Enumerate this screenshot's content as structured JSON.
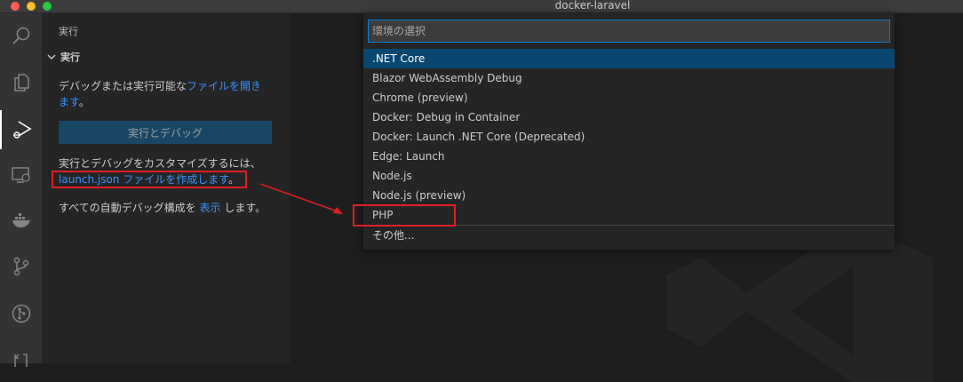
{
  "window": {
    "title": "docker-laravel"
  },
  "activity_bar": {
    "items": [
      "search-icon",
      "files-icon",
      "run-debug-icon",
      "remote-explorer-icon",
      "docker-icon",
      "source-control-icon",
      "git-graph-icon",
      "history-icon"
    ],
    "active": "run-debug-icon"
  },
  "sidebar": {
    "title": "実行",
    "section_label": "実行",
    "intro_prefix": "デバッグまたは実行可能な",
    "intro_link": "ファイルを開き",
    "intro_link_2": "ます",
    "intro_suffix": "。",
    "run_button_label": "実行とデバッグ",
    "customize_text": "実行とデバッグをカスタマイズするには、",
    "launch_link": "launch.json ファイルを作成します",
    "launch_suffix": "。",
    "show_all_prefix": "すべての自動デバッグ構成を",
    "show_all_link": "表示",
    "show_all_suffix": "します。"
  },
  "quick_pick": {
    "placeholder": "環境の選択",
    "items": [
      ".NET Core",
      "Blazor WebAssembly Debug",
      "Chrome (preview)",
      "Docker: Debug in Container",
      "Docker: Launch .NET Core (Deprecated)",
      "Edge: Launch",
      "Node.js",
      "Node.js (preview)",
      "PHP",
      "その他..."
    ],
    "selected_index": 0
  },
  "colors": {
    "accent": "#007fd4",
    "selection": "#094771",
    "link": "#3794ff",
    "annotation": "#e02020"
  }
}
